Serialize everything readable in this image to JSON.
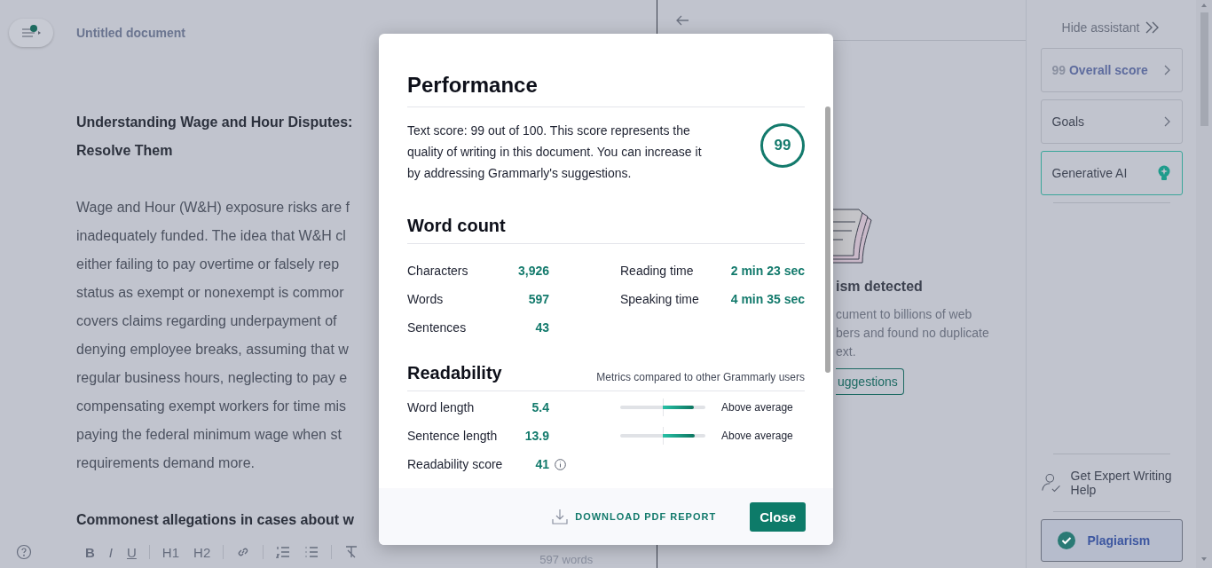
{
  "editor": {
    "title": "Untitled document",
    "heading_lines": [
      "Understanding Wage and Hour Disputes:",
      "Resolve Them"
    ],
    "paragraph_lines": [
      "Wage and Hour (W&H) exposure risks are f",
      "inadequately funded. The idea that W&H cl",
      "either failing to pay overtime or falsely rep",
      "status as exempt or nonexempt is commor",
      "covers claims regarding underpayment of",
      "denying employee breaks, assuming that w",
      "regular business hours, neglecting to pay e",
      "compensating exempt workers for time mis",
      "paying the federal minimum wage when st",
      "requirements demand more."
    ],
    "subheading": "Commonest allegations in cases about w",
    "toolbar": [
      {
        "kind": "bold",
        "label": "B"
      },
      {
        "kind": "italic",
        "label": "I"
      },
      {
        "kind": "underline",
        "label": "U"
      },
      {
        "kind": "divider"
      },
      {
        "kind": "heading",
        "label": "H1"
      },
      {
        "kind": "heading",
        "label": "H2"
      },
      {
        "kind": "divider"
      },
      {
        "kind": "link"
      },
      {
        "kind": "divider"
      },
      {
        "kind": "ordered"
      },
      {
        "kind": "bullets"
      },
      {
        "kind": "divider"
      },
      {
        "kind": "clear"
      }
    ],
    "word_count": "597 words"
  },
  "plagiarism_panel": {
    "title": "ism detected",
    "text_lines": [
      "cument to billions of web",
      "bers and found no duplicate",
      "ext."
    ],
    "button": "uggestions"
  },
  "sidebar": {
    "hide": "Hide assistant",
    "cards": [
      {
        "kind": "score",
        "score": "99",
        "label": "Overall score"
      },
      {
        "kind": "nav",
        "label": "Goals"
      },
      {
        "kind": "ai",
        "label": "Generative AI"
      }
    ],
    "expert": "Get Expert Writing Help",
    "plagiarism": "Plagiarism"
  },
  "modal": {
    "title": "Performance",
    "score_text": "Text score: 99 out of 100. This score represents the quality of writing in this document. You can increase it by addressing Grammarly's suggestions.",
    "score": "99",
    "word_count": {
      "title": "Word count",
      "left": [
        {
          "label": "Characters",
          "value": "3,926"
        },
        {
          "label": "Words",
          "value": "597"
        },
        {
          "label": "Sentences",
          "value": "43"
        }
      ],
      "right": [
        {
          "label": "Reading time",
          "value": "2 min 23 sec"
        },
        {
          "label": "Speaking time",
          "value": "4 min 35 sec"
        }
      ]
    },
    "readability": {
      "title": "Readability",
      "note": "Metrics compared to other Grammarly users",
      "metrics": [
        {
          "label": "Word length",
          "value": "5.4",
          "level": 0.86,
          "rating": "Above average"
        },
        {
          "label": "Sentence length",
          "value": "13.9",
          "level": 0.88,
          "rating": "Above average"
        }
      ],
      "score": {
        "label": "Readability score",
        "value": "41"
      }
    },
    "download": "DOWNLOAD PDF REPORT",
    "close": "Close"
  }
}
